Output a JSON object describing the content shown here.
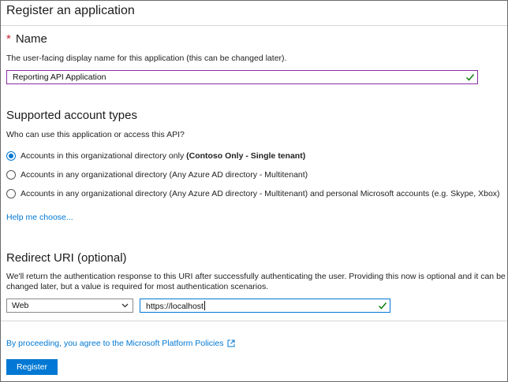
{
  "header": {
    "title": "Register an application"
  },
  "name_section": {
    "required_mark": "*",
    "title": "Name",
    "description": "The user-facing display name for this application (this can be changed later).",
    "input_value": "Reporting API Application",
    "valid_icon": "check-icon"
  },
  "account_types": {
    "title": "Supported account types",
    "question": "Who can use this application or access this API?",
    "options": [
      {
        "label": "Accounts in this organizational directory only ",
        "bold": "(Contoso Only - Single tenant)",
        "selected": true
      },
      {
        "label": "Accounts in any organizational directory (Any Azure AD directory - Multitenant)",
        "bold": "",
        "selected": false
      },
      {
        "label": "Accounts in any organizational directory (Any Azure AD directory - Multitenant) and personal Microsoft accounts (e.g. Skype, Xbox)",
        "bold": "",
        "selected": false
      }
    ],
    "help_link": "Help me choose..."
  },
  "redirect": {
    "title": "Redirect URI (optional)",
    "description_line1": "We'll return the authentication response to this URI after successfully authenticating the user. Providing this now is optional and it can be",
    "description_line2": "changed later, but a value is required for most authentication scenarios.",
    "platform_value": "Web",
    "uri_value": "https://localhost"
  },
  "footer": {
    "policy_text": "By proceeding, you agree to the Microsoft Platform Policies",
    "register_label": "Register"
  },
  "colors": {
    "accent": "#0078d4",
    "valid": "#107c10",
    "required": "#c4262e",
    "focus_purple": "#8a2ea6"
  }
}
